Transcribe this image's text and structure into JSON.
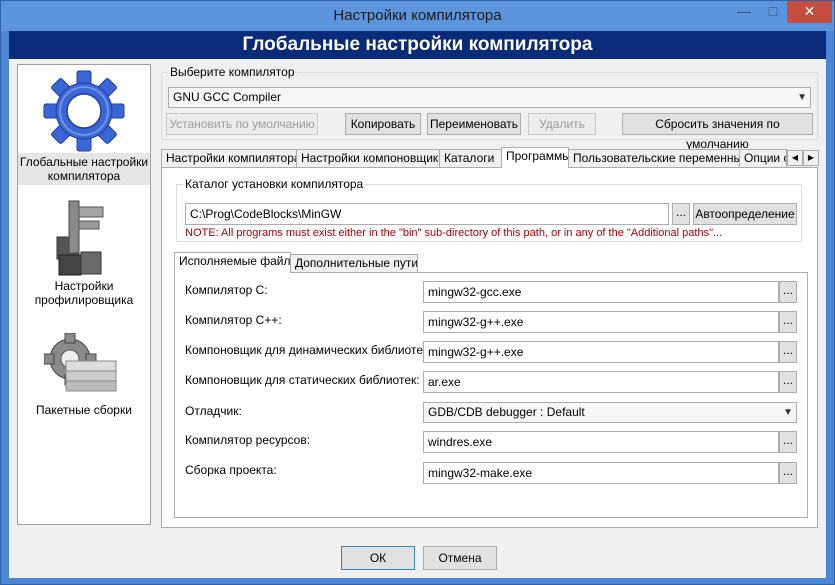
{
  "window": {
    "title": "Настройки компилятора",
    "minimize_glyph": "—",
    "maximize_glyph": "□",
    "close_glyph": "✕"
  },
  "banner": "Глобальные настройки компилятора",
  "sidebar": {
    "items": [
      {
        "label": "Глобальные настройки компилятора",
        "icon": "gear-icon"
      },
      {
        "label": "Настройки профилировщика",
        "icon": "profiler-icon"
      },
      {
        "label": "Пакетные сборки",
        "icon": "batch-build-icon"
      }
    ]
  },
  "compiler_select": {
    "group_title": "Выберите компилятор",
    "selected": "GNU GCC Compiler",
    "buttons": {
      "set_default": "Установить по умолчанию",
      "copy": "Копировать",
      "rename": "Переименовать",
      "delete": "Удалить",
      "reset": "Сбросить значения по умолчанию"
    }
  },
  "main_tabs": [
    "Настройки компилятора",
    "Настройки компоновщика",
    "Каталоги",
    "Программы",
    "Пользовательские переменные",
    "Опции с"
  ],
  "install_dir": {
    "group_title": "Каталог установки компилятора",
    "path": "C:\\Prog\\CodeBlocks\\MinGW",
    "browse": "...",
    "autodetect": "Автоопределение",
    "note": "NOTE: All programs must exist either in the \"bin\" sub-directory of this path, or in any of the \"Additional paths\"..."
  },
  "sub_tabs": [
    "Исполняемые файлы",
    "Дополнительные пути"
  ],
  "programs": [
    {
      "label": "Компилятор C:",
      "value": "mingw32-gcc.exe",
      "type": "text"
    },
    {
      "label": "Компилятор C++:",
      "value": "mingw32-g++.exe",
      "type": "text"
    },
    {
      "label": "Компоновщик для динамических библиотек:",
      "value": "mingw32-g++.exe",
      "type": "text"
    },
    {
      "label": "Компоновщик для статических библиотек:",
      "value": "ar.exe",
      "type": "text"
    },
    {
      "label": "Отладчик:",
      "value": "GDB/CDB debugger : Default",
      "type": "combo"
    },
    {
      "label": "Компилятор ресурсов:",
      "value": "windres.exe",
      "type": "text"
    },
    {
      "label": "Сборка проекта:",
      "value": "mingw32-make.exe",
      "type": "text"
    }
  ],
  "dialog_buttons": {
    "ok": "ОК",
    "cancel": "Отмена"
  }
}
